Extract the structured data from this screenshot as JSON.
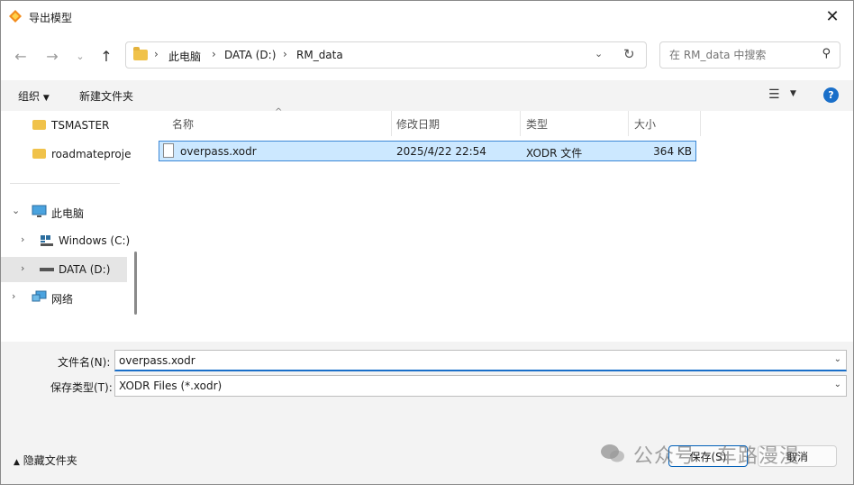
{
  "window": {
    "title": "导出模型"
  },
  "nav": {
    "breadcrumbs": [
      "此电脑",
      "DATA (D:)",
      "RM_data"
    ],
    "search_placeholder": "在 RM_data 中搜索"
  },
  "toolbar": {
    "organize": "组织",
    "new_folder": "新建文件夹"
  },
  "sidebar": {
    "items": [
      {
        "label": "TSMASTER"
      },
      {
        "label": "roadmateproje"
      },
      {
        "label": "此电脑"
      },
      {
        "label": "Windows (C:)"
      },
      {
        "label": "DATA (D:)"
      },
      {
        "label": "网络"
      }
    ]
  },
  "columns": {
    "name": "名称",
    "date": "修改日期",
    "type": "类型",
    "size": "大小"
  },
  "files": [
    {
      "name": "overpass.xodr",
      "date": "2025/4/22 22:54",
      "type": "XODR 文件",
      "size": "364 KB"
    }
  ],
  "form": {
    "filename_label": "文件名(N):",
    "filename_value": "overpass.xodr",
    "filetype_label": "保存类型(T):",
    "filetype_value": "XODR Files (*.xodr)"
  },
  "footer": {
    "hide_folders": "隐藏文件夹",
    "save": "保存(S)",
    "cancel": "取消",
    "watermark": "公众号 · 车路漫漫"
  },
  "colors": {
    "accent": "#005fb8",
    "selection": "#cce8ff",
    "help": "#1a6fc9"
  }
}
